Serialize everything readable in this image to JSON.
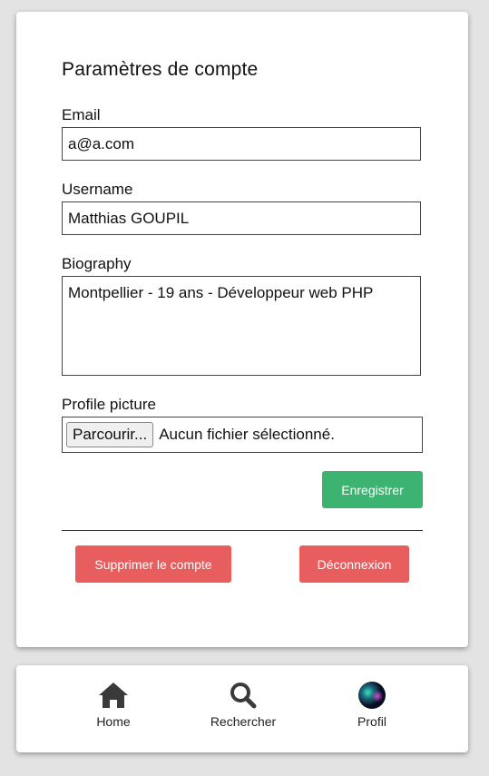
{
  "settings": {
    "title": "Paramètres de compte",
    "email_label": "Email",
    "email_value": "a@a.com",
    "username_label": "Username",
    "username_value": "Matthias GOUPIL",
    "bio_label": "Biography",
    "bio_value": "Montpellier - 19 ans - Développeur web PHP",
    "picture_label": "Profile picture",
    "file_button": "Parcourir...",
    "file_status": "Aucun fichier sélectionné.",
    "save_button": "Enregistrer",
    "delete_button": "Supprimer le compte",
    "logout_button": "Déconnexion"
  },
  "nav": {
    "items": [
      {
        "label": "Home",
        "icon": "home-icon"
      },
      {
        "label": "Rechercher",
        "icon": "search-icon"
      },
      {
        "label": "Profil",
        "icon": "avatar"
      }
    ]
  },
  "colors": {
    "save": "#3cb371",
    "danger": "#e85d5d",
    "background": "#e3e3e3"
  }
}
